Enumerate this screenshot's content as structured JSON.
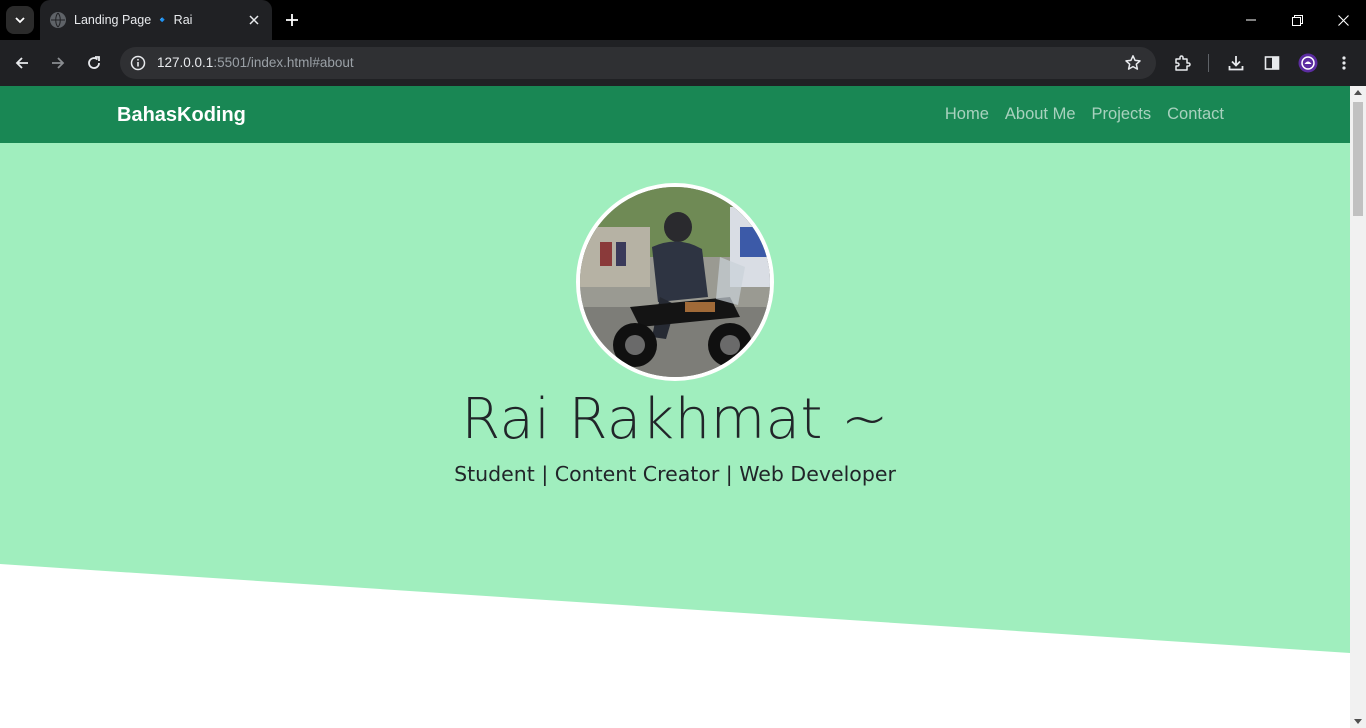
{
  "browser": {
    "tab_title": "Landing Page 🔹 Rai",
    "url_host": "127.0.0.1",
    "url_rest": ":5501/index.html#about"
  },
  "site": {
    "brand": "BahasKoding",
    "nav": [
      "Home",
      "About Me",
      "Projects",
      "Contact"
    ],
    "name": "Rai Rakhmat ~",
    "tagline": "Student | Content Creator | Web Developer",
    "colors": {
      "navbar": "#198754",
      "hero_bg": "#a0eebe",
      "text": "#212529"
    }
  }
}
